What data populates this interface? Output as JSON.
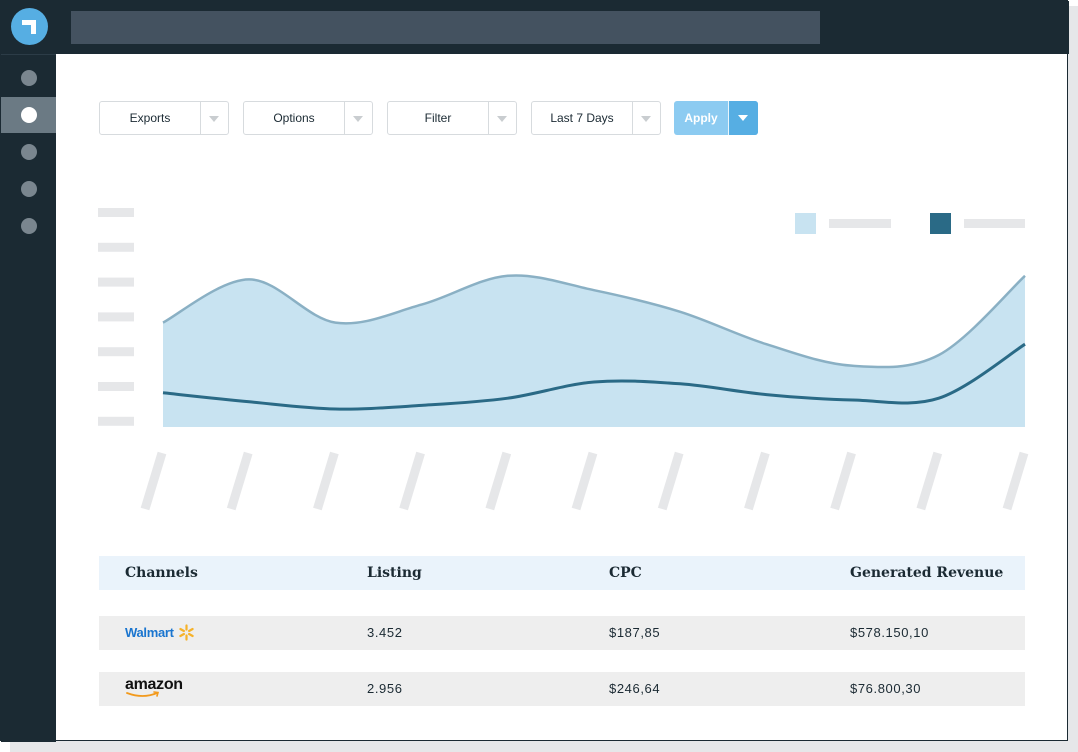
{
  "toolbar": {
    "dropdowns": [
      {
        "label": "Exports"
      },
      {
        "label": "Options"
      },
      {
        "label": "Filter"
      },
      {
        "label": "Last 7 Days"
      }
    ],
    "apply_label": "Apply"
  },
  "colors": {
    "nav_bg": "#1b2a33",
    "accent": "#56aee3",
    "area_fill": "#c8e3f1",
    "area_line": "#8ab0c4",
    "line_dark": "#2a6a86",
    "placeholder": "#e6e7e9"
  },
  "sidebar": {
    "items": [
      {
        "icon": "dot",
        "active": false
      },
      {
        "icon": "dot",
        "active": true
      },
      {
        "icon": "dot",
        "active": false
      },
      {
        "icon": "dot",
        "active": false
      },
      {
        "icon": "dot",
        "active": false
      }
    ]
  },
  "chart_data": {
    "type": "area",
    "title": "",
    "xlabel": "",
    "ylabel": "",
    "note": "axis tick labels and legend text are rendered as gray placeholder bars",
    "x": [
      0,
      1,
      2,
      3,
      4,
      5,
      6,
      7,
      8,
      9,
      10
    ],
    "ylim": [
      0,
      6
    ],
    "grid": false,
    "legend": "top-right",
    "series": [
      {
        "type": "area",
        "color": "#c8e3f1",
        "values": [
          2.9,
          4.1,
          2.9,
          3.4,
          4.2,
          3.8,
          3.2,
          2.3,
          1.7,
          2.0,
          4.2
        ]
      },
      {
        "type": "line",
        "color": "#2a6a86",
        "values": [
          0.95,
          0.7,
          0.5,
          0.6,
          0.8,
          1.25,
          1.2,
          0.9,
          0.75,
          0.8,
          2.3
        ]
      }
    ]
  },
  "table": {
    "headers": [
      "Channels",
      "Listing",
      "CPC",
      "Generated Revenue"
    ],
    "rows": [
      {
        "channel": "Walmart",
        "listing": "3.452",
        "cpc": "$187,85",
        "revenue": "$578.150,10"
      },
      {
        "channel": "amazon",
        "listing": "2.956",
        "cpc": "$246,64",
        "revenue": "$76.800,30"
      }
    ]
  }
}
